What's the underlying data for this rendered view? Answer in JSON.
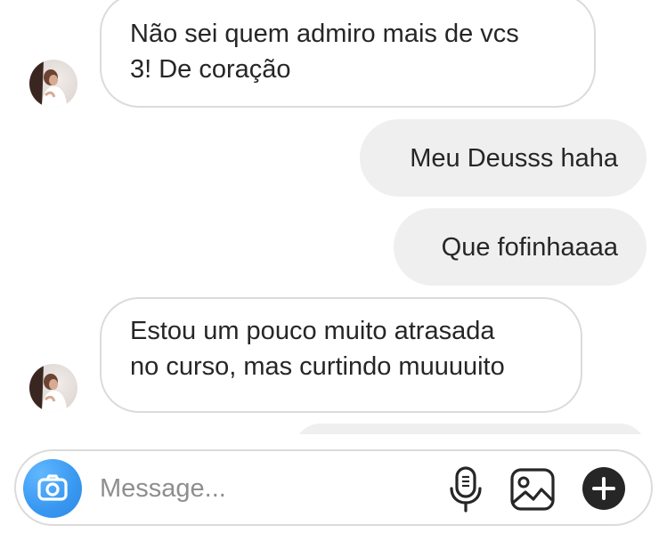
{
  "messages": [
    {
      "direction": "in",
      "lines": [
        "Não sei quem admiro mais de vcs",
        "3! De coração"
      ]
    },
    {
      "direction": "out",
      "text": "Meu Deusss haha"
    },
    {
      "direction": "out",
      "text": "Que fofinhaaaa"
    },
    {
      "direction": "in",
      "lines": [
        "Estou um pouco muito atrasada",
        "no curso, mas curtindo muuuuito"
      ]
    }
  ],
  "composer": {
    "placeholder": "Message...",
    "icons": [
      "camera-icon",
      "microphone-icon",
      "gallery-icon",
      "plus-icon"
    ]
  },
  "colors": {
    "accent": "#3897f0",
    "incoming_border": "#dbdbdb",
    "outgoing_bg": "#efefef",
    "text": "#262626",
    "placeholder": "#8e8e8e"
  }
}
